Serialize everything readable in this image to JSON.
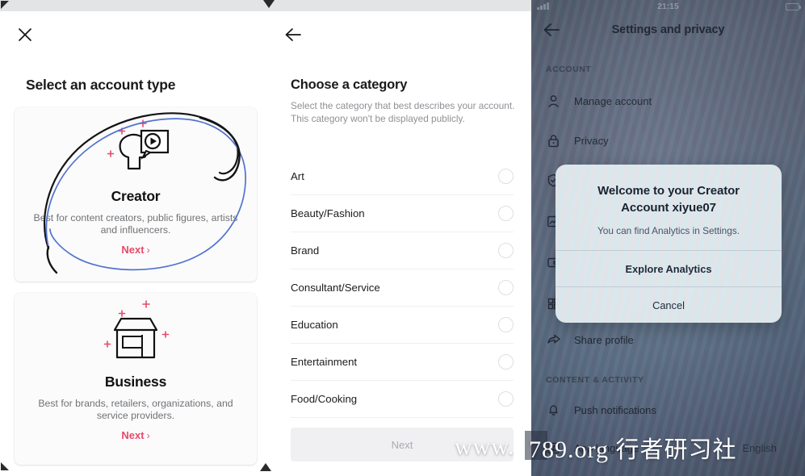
{
  "panel1": {
    "close_icon": "close-icon",
    "title": "Select an account type",
    "cards": [
      {
        "name": "Creator",
        "icon": "creator-head-play-icon",
        "description": "Best for content creators, public figures, artists and influencers.",
        "next_label": "Next",
        "next_chevron": "›"
      },
      {
        "name": "Business",
        "icon": "storefront-icon",
        "description": "Best for brands, retailers, organizations, and service providers.",
        "next_label": "Next",
        "next_chevron": "›"
      }
    ],
    "annotation": {
      "ink_black": "#1a1a1a",
      "ink_blue": "#4a68c8",
      "highlights": "Creator card circled twice by hand"
    },
    "accent_pink": "#e8486b"
  },
  "panel2": {
    "back_icon": "back-arrow-icon",
    "title": "Choose a category",
    "subtitle": "Select the category that best describes your account. This category won't be displayed publicly.",
    "categories": [
      {
        "label": "Art",
        "selected": false
      },
      {
        "label": "Beauty/Fashion",
        "selected": false
      },
      {
        "label": "Brand",
        "selected": false
      },
      {
        "label": "Consultant/Service",
        "selected": false
      },
      {
        "label": "Education",
        "selected": false
      },
      {
        "label": "Entertainment",
        "selected": false
      },
      {
        "label": "Food/Cooking",
        "selected": false
      }
    ],
    "next_button": "Next"
  },
  "panel3": {
    "status_bar": {
      "time": "21:15"
    },
    "back_icon": "back-arrow-icon",
    "header_title": "Settings and privacy",
    "sections": [
      {
        "label": "ACCOUNT",
        "items": [
          {
            "label": "Manage account",
            "icon": "person-icon"
          },
          {
            "label": "Privacy",
            "icon": "lock-icon"
          },
          {
            "label": "",
            "icon": "shield-check-icon"
          },
          {
            "label": "",
            "icon": "analytics-chart-icon"
          },
          {
            "label": "",
            "icon": "wallet-icon"
          },
          {
            "label": "",
            "icon": "apps-grid-icon"
          },
          {
            "label": "Share profile",
            "icon": "share-arrow-icon"
          }
        ]
      },
      {
        "label": "CONTENT & ACTIVITY",
        "items": [
          {
            "label": "Push notifications",
            "icon": "bell-icon"
          },
          {
            "label": "App language",
            "icon": "language-icon",
            "value": "English"
          }
        ]
      }
    ],
    "dialog": {
      "title": "Welcome to your Creator Account xiyue07",
      "message": "You can find Analytics in Settings.",
      "primary_button": "Explore Analytics",
      "cancel_button": "Cancel"
    }
  },
  "watermark": {
    "left_text": "www.",
    "right_text": "789.org",
    "cjk_text": "行者研习社"
  }
}
